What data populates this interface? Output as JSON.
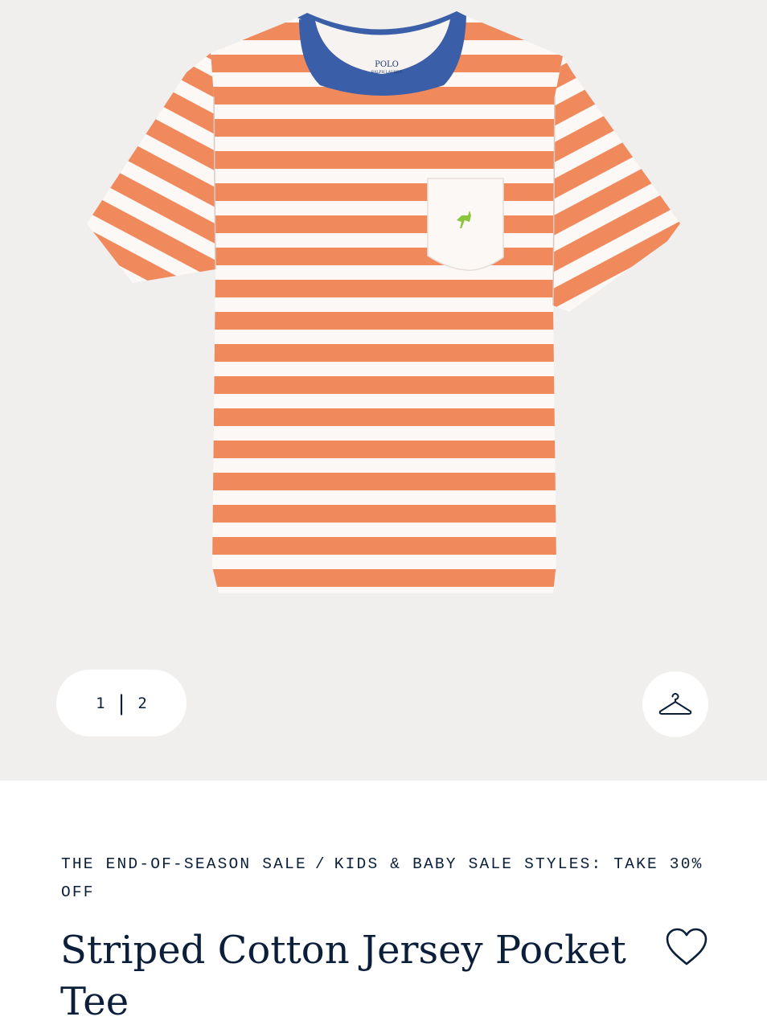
{
  "gallery": {
    "current_page": "1",
    "separator": "|",
    "total_pages": "2",
    "shirt_colors": {
      "stripe": "#f08a5d",
      "white": "#fbf8f6",
      "collar": "#3b5ea8",
      "logo": "#8cc63f"
    },
    "collar_label_brand": "POLO",
    "collar_label_sub": "RALPH LAUREN",
    "hanger_icon": "hanger-icon"
  },
  "breadcrumb": {
    "first": "THE END-OF-SEASON SALE",
    "divider": "/",
    "second": "KIDS & BABY SALE STYLES: TAKE 30% OFF"
  },
  "product": {
    "title": "Striped Cotton Jersey Pocket Tee",
    "wishlist_icon": "heart-icon"
  }
}
